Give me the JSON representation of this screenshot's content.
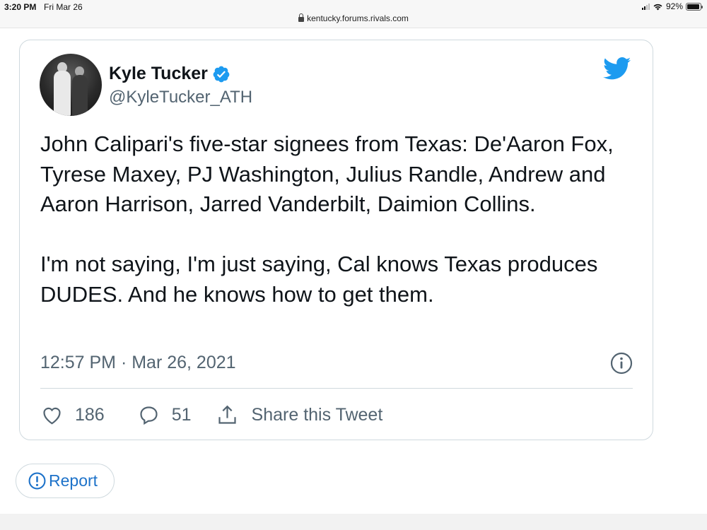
{
  "status_bar": {
    "time": "3:20 PM",
    "date": "Fri Mar 26",
    "battery_percent": "92%",
    "battery_level": 0.92,
    "url": "kentucky.forums.rivals.com"
  },
  "tweet": {
    "author_name": "Kyle Tucker",
    "author_handle": "@KyleTucker_ATH",
    "verified": true,
    "text_paragraph_1": "John Calipari's five-star signees from Texas: De'Aaron Fox, Tyrese Maxey, PJ Washington, Julius Randle, Andrew and Aaron Harrison, Jarred Vanderbilt, Daimion Collins.",
    "text_paragraph_2": "I'm not saying, I'm just saying, Cal knows Texas produces DUDES. And he knows how to get them.",
    "timestamp": "12:57 PM · Mar 26, 2021",
    "like_count": "186",
    "reply_count": "51",
    "share_label": "Share this Tweet"
  },
  "report": {
    "label": "Report"
  },
  "icons": {
    "like": "heart-icon",
    "reply": "speech-bubble-icon",
    "share": "share-upload-icon",
    "info": "info-icon",
    "brand": "twitter-bird-icon",
    "verified": "verified-badge-icon",
    "report": "exclamation-circle-icon"
  },
  "colors": {
    "twitter_blue": "#1d9bf0",
    "secondary_text": "#536471",
    "border": "#cfd9de",
    "report_blue": "#1d72c9"
  }
}
